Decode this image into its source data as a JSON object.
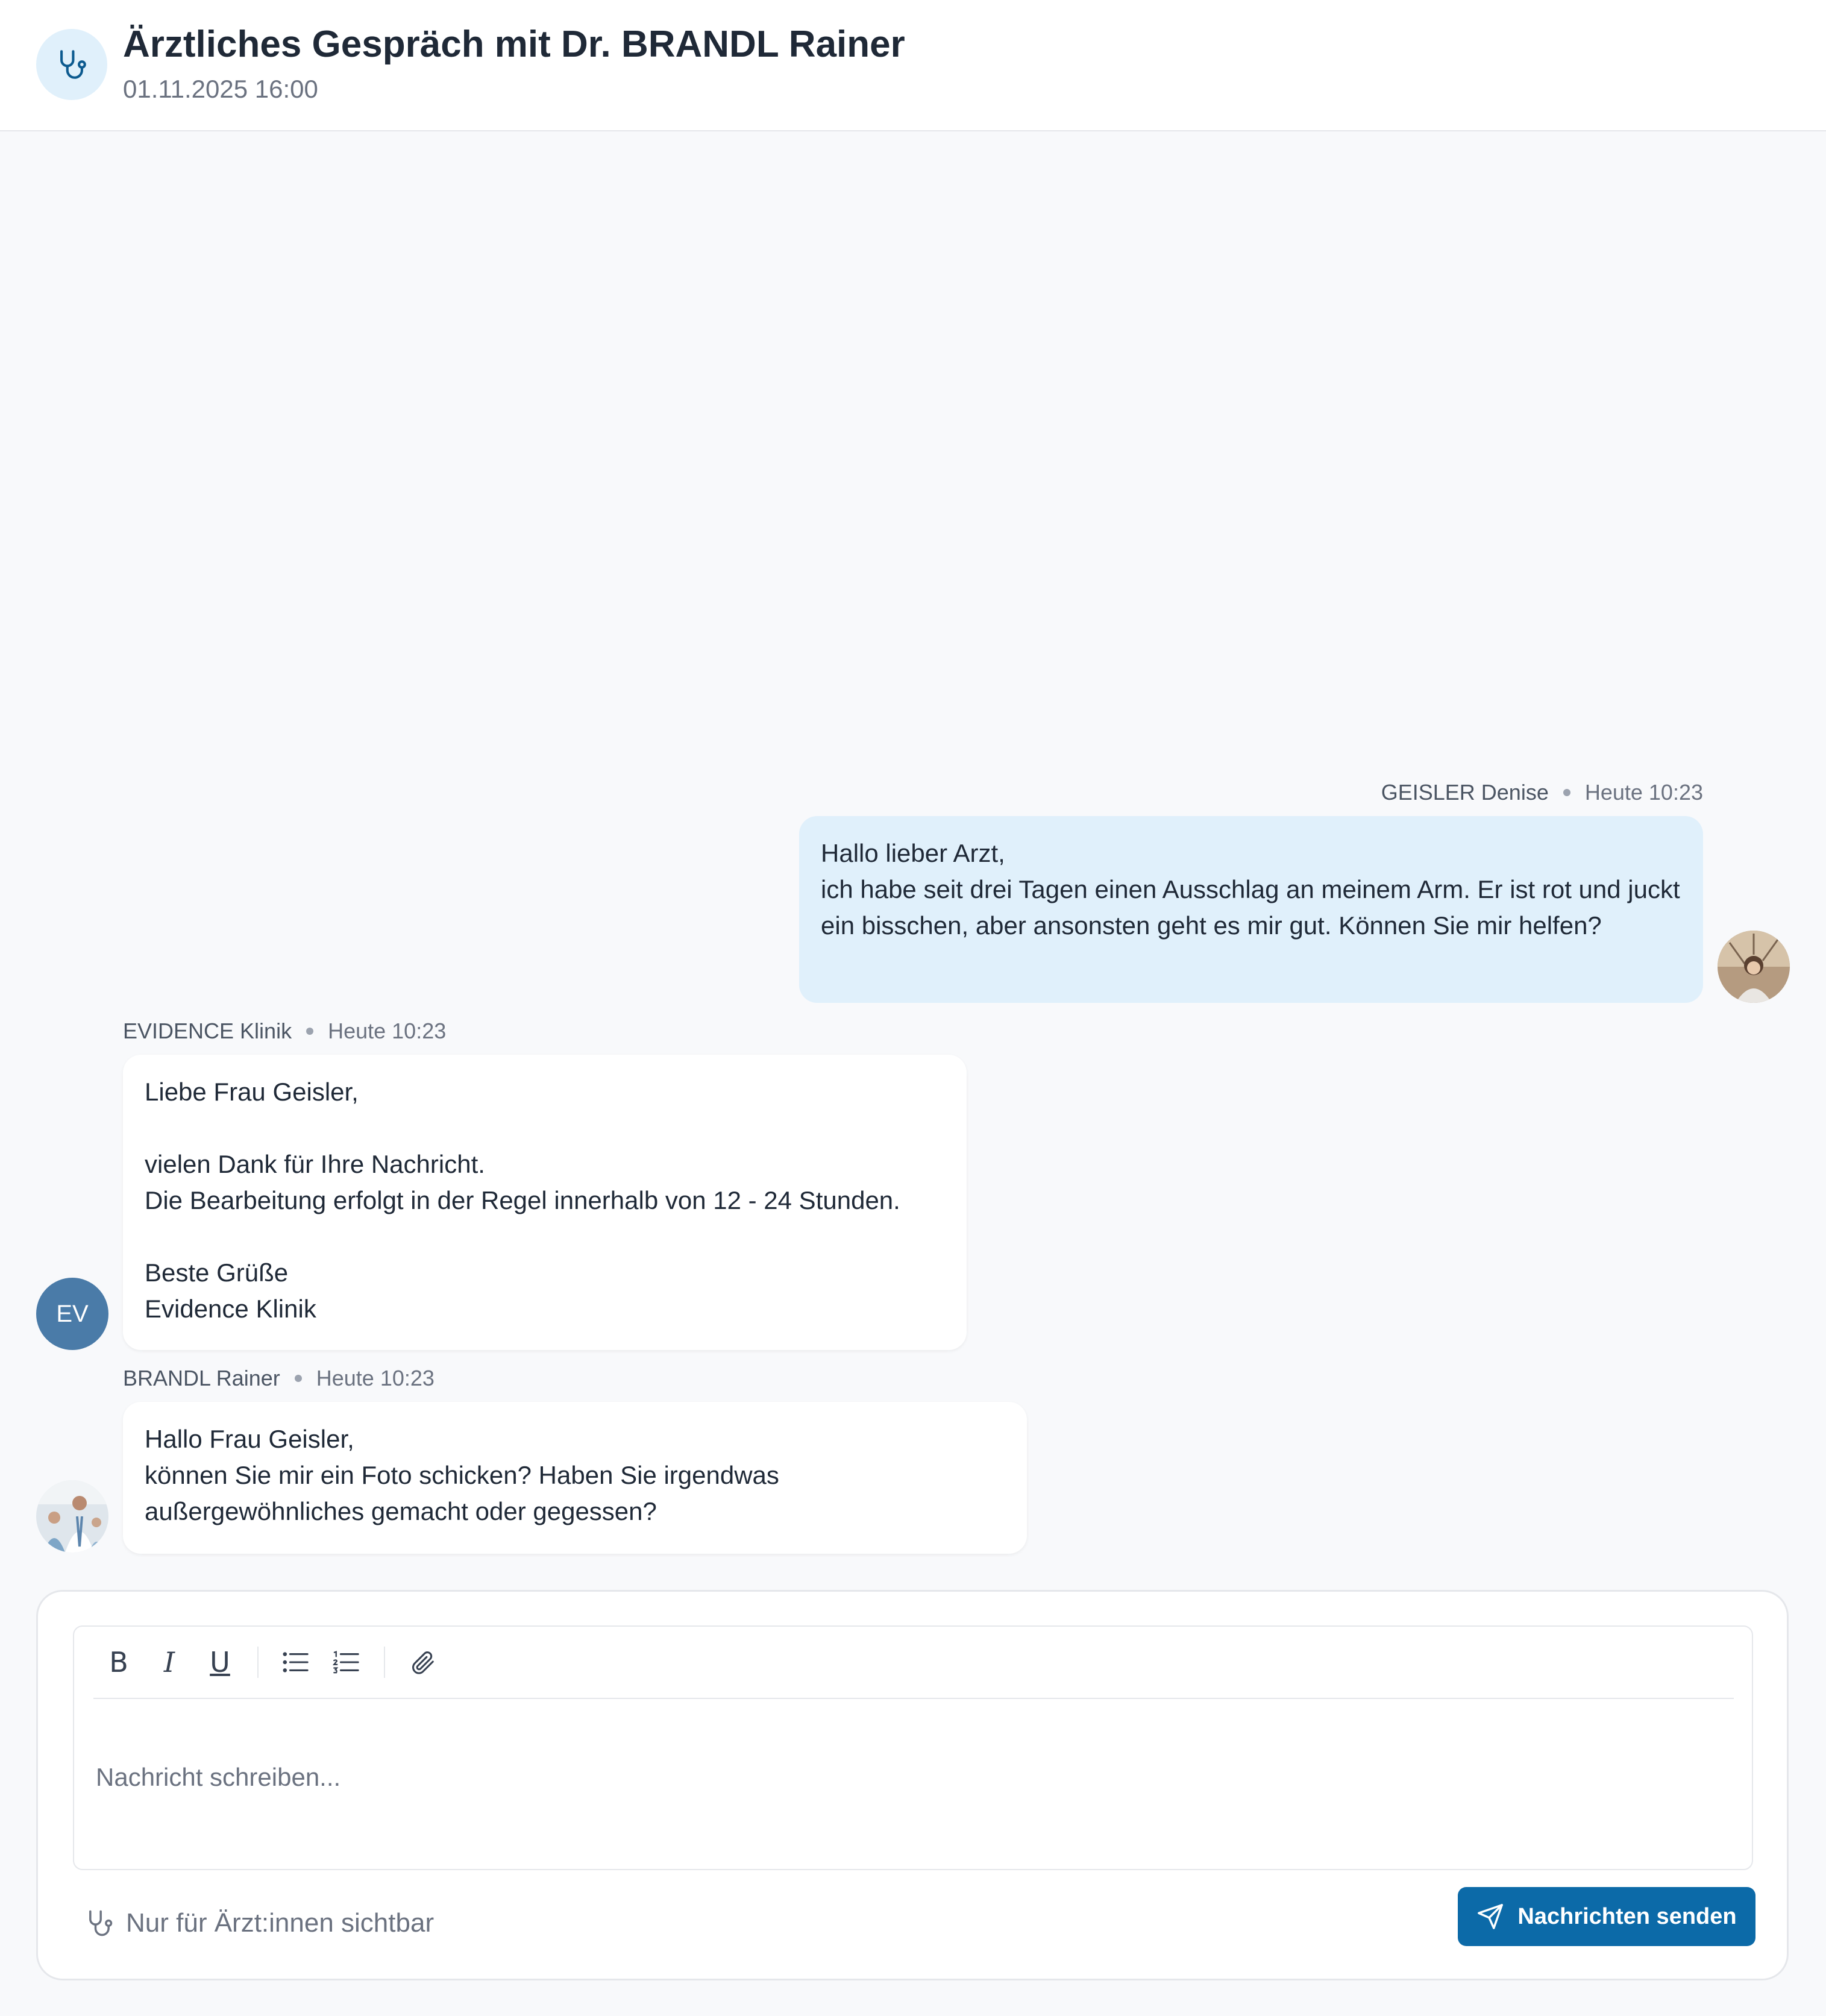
{
  "header": {
    "icon": "stethoscope-icon",
    "title": "Ärztliches Gespräch mit Dr. BRANDL Rainer",
    "subtitle": "01.11.2025 16:00"
  },
  "messages": [
    {
      "sender": "GEISLER Denise",
      "time": "Heute 10:23",
      "direction": "outgoing",
      "avatar": "photo",
      "text": "Hallo lieber Arzt,\nich habe seit drei Tagen einen Ausschlag an meinem Arm. Er ist rot und juckt ein bisschen, aber ansonsten geht es mir gut. Können Sie mir helfen?"
    },
    {
      "sender": "EVIDENCE Klinik",
      "time": "Heute 10:23",
      "direction": "incoming",
      "avatar_initials": "EV",
      "text": "Liebe Frau Geisler,\n\nvielen Dank für Ihre Nachricht.\nDie Bearbeitung erfolgt in der Regel innerhalb von 12 - 24 Stunden.\n\nBeste Grüße\nEvidence Klinik"
    },
    {
      "sender": "BRANDL Rainer",
      "time": "Heute 10:23",
      "direction": "incoming",
      "avatar": "photo",
      "text": "Hallo Frau Geisler,\nkönnen Sie mir ein Foto schicken? Haben Sie irgendwas außergewöhnliches gemacht oder gegessen?"
    }
  ],
  "composer": {
    "toolbar": {
      "bold": "B",
      "italic": "I",
      "underline": "U",
      "icons": [
        "bold-icon",
        "italic-icon",
        "underline-icon",
        "bullet-list-icon",
        "numbered-list-icon",
        "paperclip-icon"
      ]
    },
    "placeholder": "Nachricht schreiben...",
    "value": "",
    "visibility_label": "Nur für Ärzt:innen sichtbar",
    "send_label": "Nachrichten senden"
  },
  "colors": {
    "accent": "#0c6aa8",
    "outgoing_bubble": "#e0f0fb",
    "incoming_bubble": "#ffffff",
    "initials_avatar": "#4a7ba8",
    "background": "#f8f9fb"
  }
}
